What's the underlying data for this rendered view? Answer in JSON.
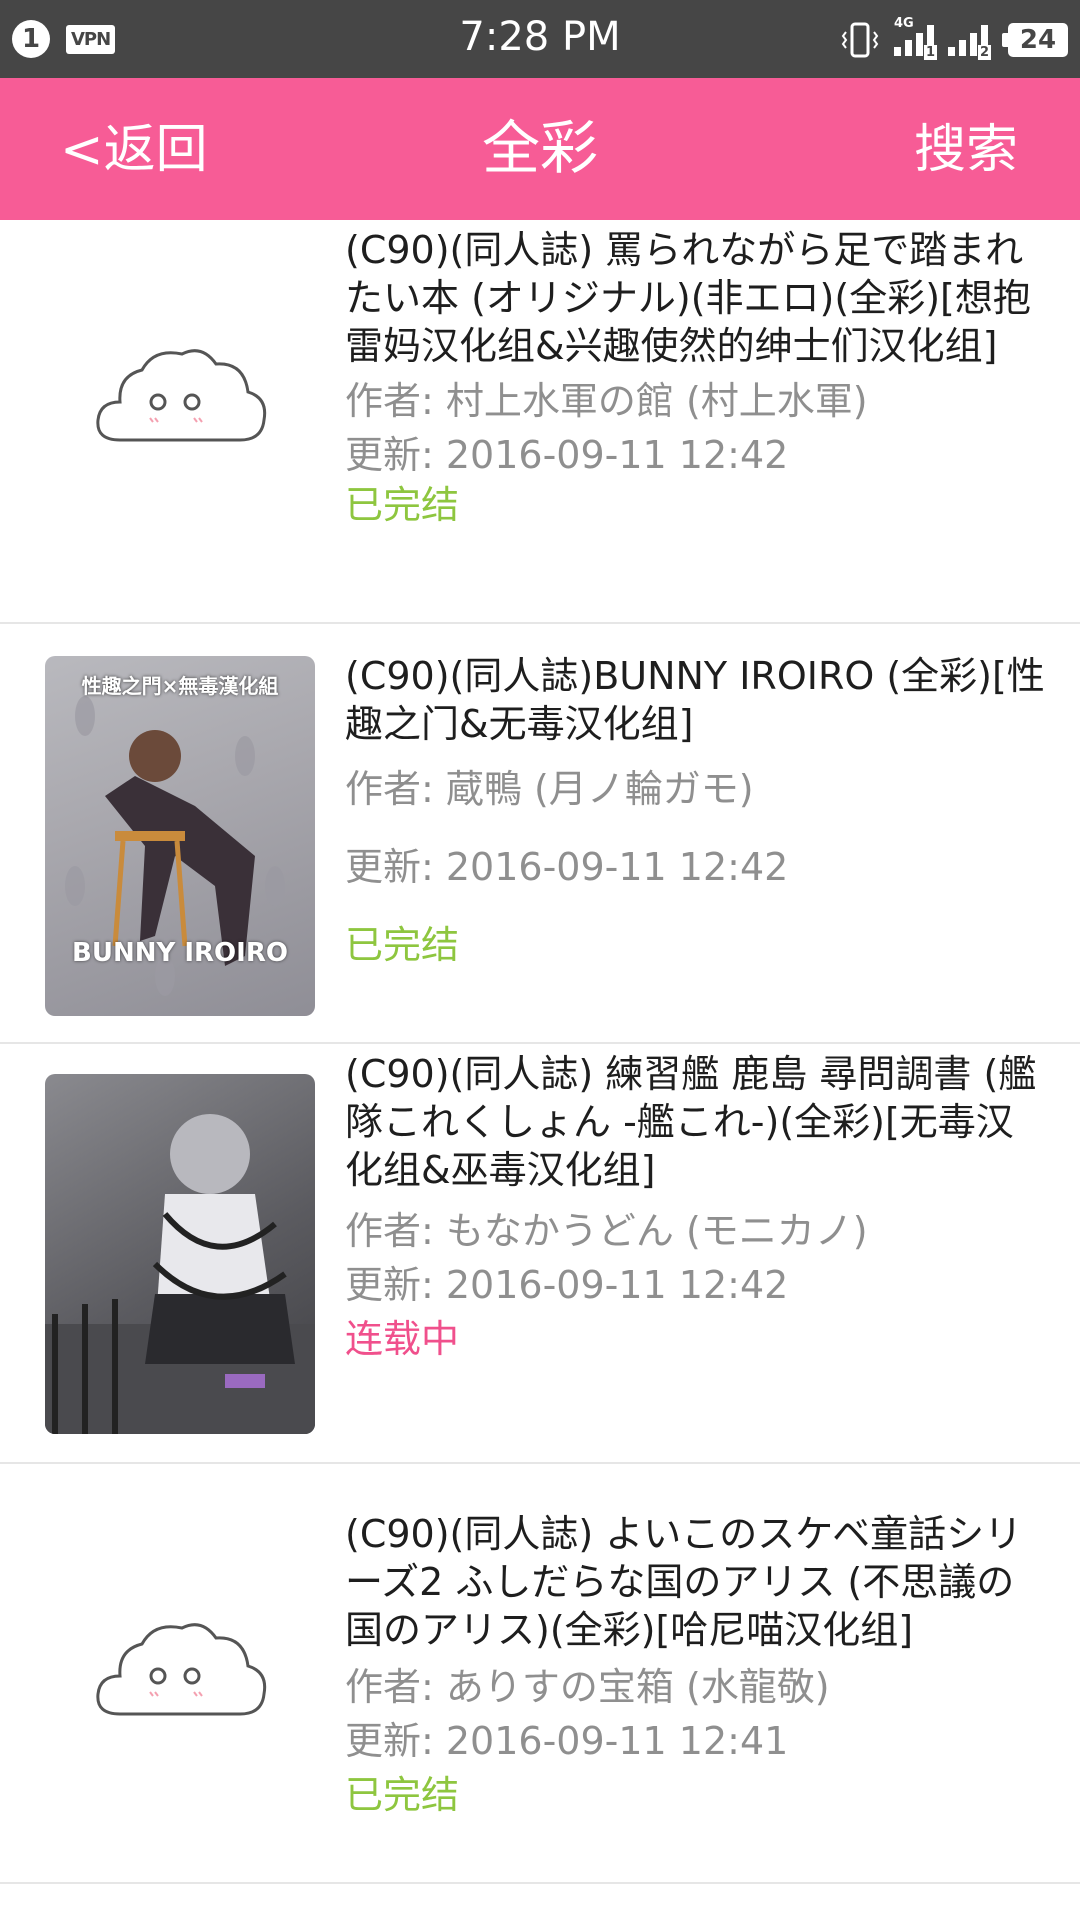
{
  "status_bar": {
    "notification_count": "1",
    "vpn_label": "VPN",
    "time": "7:28 PM",
    "network_type": "4G",
    "sim1_label": "1",
    "sim2_label": "2",
    "battery_level": "24"
  },
  "header": {
    "back_label": "<返回",
    "title": "全彩",
    "search_label": "搜索",
    "background_color": "#f75c96"
  },
  "items": [
    {
      "title": "(C90)(同人誌) 罵られながら足で踏まれたい本 (オリジナル)(非エロ)(全彩)[想抱雷妈汉化组&兴趣使然的绅士们汉化组]",
      "author": "作者:  村上水軍の館 (村上水軍)",
      "updated": "更新:  2016-09-11 12:42",
      "status": "已完结",
      "thumbnail": "placeholder-cloud-icon"
    },
    {
      "title": "(C90)(同人誌)BUNNY IROIRO (全彩)[性趣之门&无毒汉化组]",
      "author": "作者:  蔵鴨 (月ノ輪ガモ)",
      "updated": "更新:  2016-09-11 12:42",
      "status": "已完结",
      "thumbnail": "cover-image",
      "cover_text": "BUNNY IROIRO",
      "cover_top_text": "性趣之門×無毒漢化組"
    },
    {
      "title": "(C90)(同人誌) 練習艦 鹿島 尋問調書 (艦隊これくしょん -艦これ-)(全彩)[无毒汉化组&巫毒汉化组]",
      "author": "作者:  もなかうどん (モニカノ)",
      "updated": "更新:  2016-09-11 12:42",
      "status": "连载中",
      "thumbnail": "cover-image"
    },
    {
      "title": "(C90)(同人誌) よいこのスケベ童話シリーズ2 ふしだらな国のアリス (不思議の国のアリス)(全彩)[哈尼喵汉化组]",
      "author": "作者:  ありすの宝箱 (水龍敬)",
      "updated": "更新:  2016-09-11 12:41",
      "status": "已完结",
      "thumbnail": "placeholder-cloud-icon"
    }
  ],
  "colors": {
    "status_done": "#8ec63f",
    "status_ongoing": "#f0508c"
  }
}
